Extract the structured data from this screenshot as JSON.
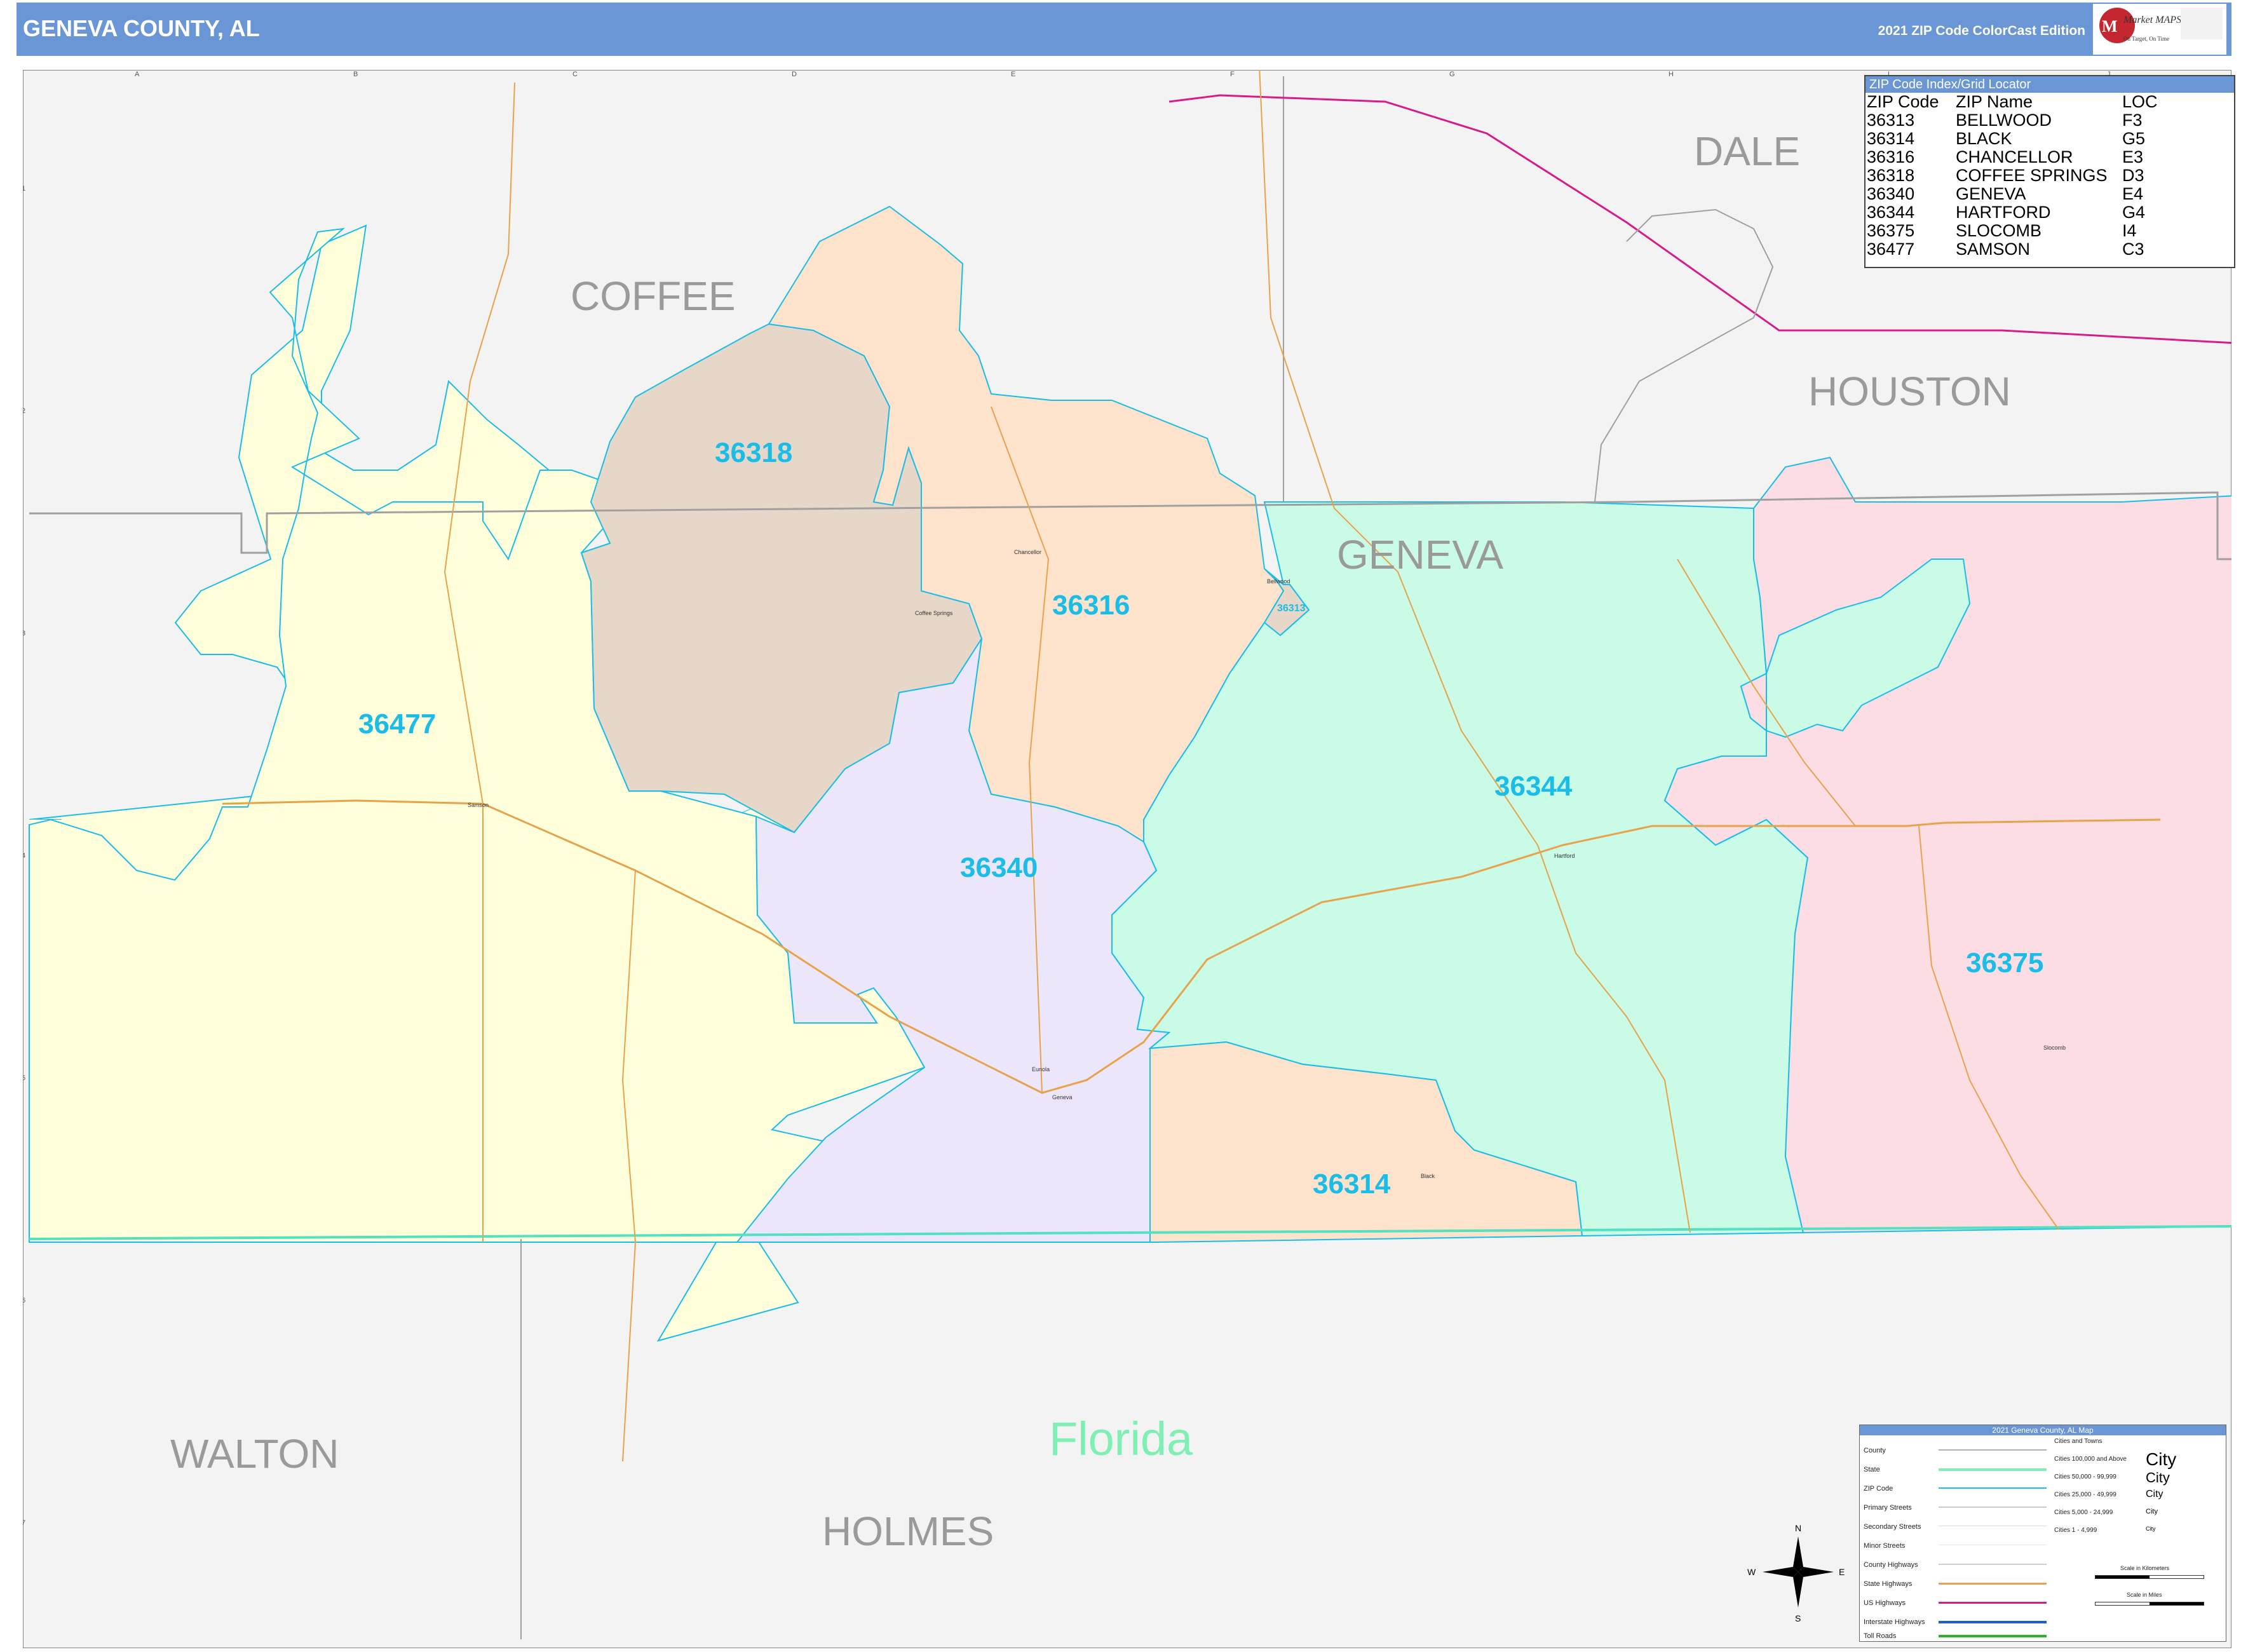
{
  "header": {
    "title": "GENEVA COUNTY, AL",
    "edition": "2021 ZIP Code ColorCast Edition",
    "logo_brand": "Market MAPS",
    "logo_tagline": "On Target, On Time"
  },
  "grid": {
    "columns": [
      "A",
      "B",
      "C",
      "D",
      "E",
      "F",
      "G",
      "H",
      "I",
      "J"
    ],
    "rows": [
      "1",
      "2",
      "3",
      "4",
      "5",
      "6",
      "7"
    ]
  },
  "counties": [
    "DALE",
    "COFFEE",
    "HOUSTON",
    "GENEVA",
    "WALTON",
    "HOLMES"
  ],
  "state_label": "Florida",
  "zip_labels": [
    "36318",
    "36316",
    "36477",
    "36344",
    "36340",
    "36375",
    "36314",
    "36313"
  ],
  "towns": [
    "Chancellor",
    "Coffee Springs",
    "Bellwood",
    "Samson",
    "Geneva",
    "Slocomb",
    "Hartford",
    "Black",
    "Malvern",
    "Eunola",
    "Chancellor",
    "Malone",
    "Slocomb"
  ],
  "zip_index": {
    "title": "ZIP Code Index/Grid Locator",
    "headers": [
      "ZIP Code",
      "ZIP Name",
      "LOC"
    ],
    "rows": [
      [
        "36313",
        "BELLWOOD",
        "F3"
      ],
      [
        "36314",
        "BLACK",
        "G5"
      ],
      [
        "36316",
        "CHANCELLOR",
        "E3"
      ],
      [
        "36318",
        "COFFEE SPRINGS",
        "D3"
      ],
      [
        "36340",
        "GENEVA",
        "E4"
      ],
      [
        "36344",
        "HARTFORD",
        "G4"
      ],
      [
        "36375",
        "SLOCOMB",
        "I4"
      ],
      [
        "36477",
        "SAMSON",
        "C3"
      ]
    ]
  },
  "legend": {
    "title": "2021 Geneva County, AL Map",
    "items": [
      "County",
      "State",
      "ZIP Code",
      "Primary Streets",
      "Secondary Streets",
      "Minor Streets",
      "County Highways",
      "State Highways",
      "US Highways",
      "Interstate Highways",
      "Toll Roads"
    ],
    "cities_header": "Cities and Towns",
    "city_sizes": [
      "Cities 100,000 and Above",
      "Cities 50,000 - 99,999",
      "Cities 25,000 - 49,999",
      "Cities 5,000 - 24,999",
      "Cities 1 - 4,999"
    ],
    "city_samples": [
      "City",
      "City",
      "City",
      "City",
      "City"
    ],
    "scale_km": "Scale in Kilometers",
    "scale_mi": "Scale in Miles"
  },
  "compass": [
    "N",
    "S",
    "E",
    "W"
  ],
  "colors": {
    "header": "#6a96d6",
    "zip_label": "#19bde8",
    "z36477": "#ffffdc",
    "z36318": "#e6d7c8",
    "z36316": "#fde3cc",
    "z36340": "#ece6fb",
    "z36344": "#c9fbe6",
    "z36375": "#fcdde4",
    "z36314": "#fde3cc"
  }
}
